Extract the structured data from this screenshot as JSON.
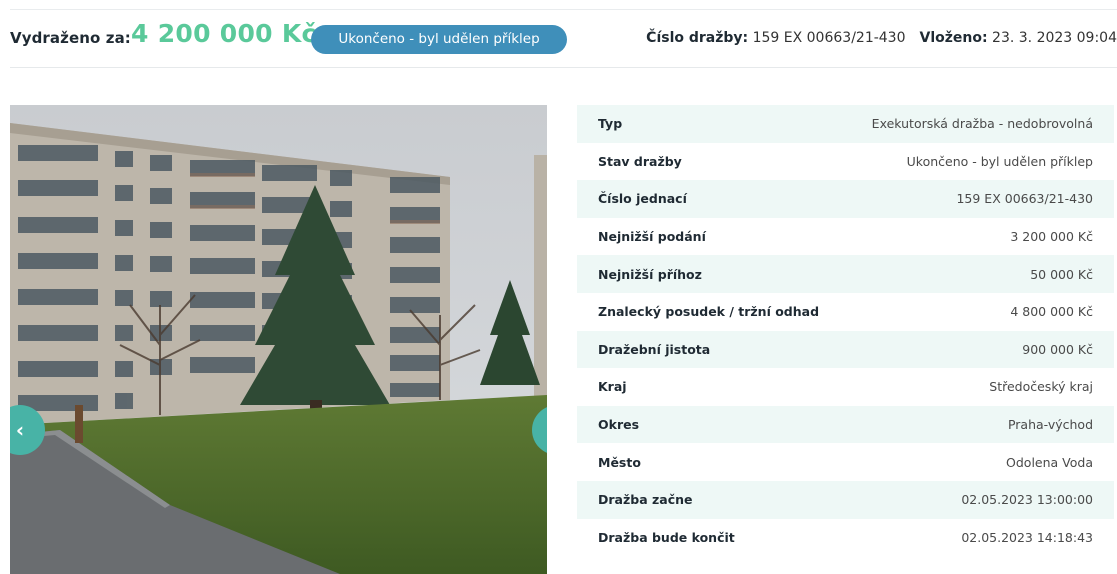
{
  "header": {
    "sold_label": "Vydraženo za:",
    "price": "4 200 000 Kč",
    "status": "Ukončeno - byl udělen příklep",
    "auction_number_label": "Číslo dražby:",
    "auction_number": "159 EX 00663/21-430",
    "inserted_label": "Vloženo:",
    "inserted": "23. 3. 2023 09:04"
  },
  "gallery": {
    "prev_icon": "‹",
    "next_icon": "›"
  },
  "colors": {
    "price": "#5ac99a",
    "status_badge": "#3f8fba",
    "nav_button": "#48b3a6",
    "row_stripe": "#eef8f6"
  },
  "params": [
    {
      "key": "Typ",
      "value": "Exekutorská dražba - nedobrovolná"
    },
    {
      "key": "Stav dražby",
      "value": "Ukončeno - byl udělen příklep"
    },
    {
      "key": "Číslo jednací",
      "value": "159 EX 00663/21-430"
    },
    {
      "key": "Nejnižší podání",
      "value": "3 200 000 Kč"
    },
    {
      "key": "Nejnižší příhoz",
      "value": "50 000 Kč"
    },
    {
      "key": "Znalecký posudek / tržní odhad",
      "value": "4 800 000 Kč"
    },
    {
      "key": "Dražební jistota",
      "value": "900 000 Kč"
    },
    {
      "key": "Kraj",
      "value": "Středočeský kraj"
    },
    {
      "key": "Okres",
      "value": "Praha-východ"
    },
    {
      "key": "Město",
      "value": "Odolena Voda"
    },
    {
      "key": "Dražba začne",
      "value": "02.05.2023 13:00:00"
    },
    {
      "key": "Dražba bude končit",
      "value": "02.05.2023 14:18:43"
    }
  ]
}
